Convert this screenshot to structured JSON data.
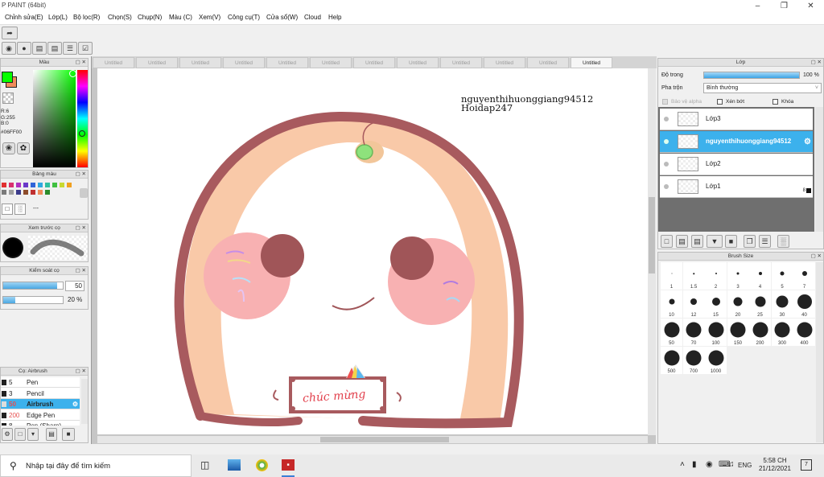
{
  "window": {
    "title": "P PAINT (64bit)"
  },
  "menu": [
    "Chỉnh sửa(E)",
    "Lớp(L)",
    "Bộ lọc(R)",
    "Chọn(S)",
    "Chụp(N)",
    "Màu (C)",
    "Xem(V)",
    "Công cụ(T)",
    "Cửa sổ(W)",
    "Cloud",
    "Help"
  ],
  "color_panel": {
    "title": "Màu",
    "r": "R:6",
    "g": "G:255",
    "b": "B:0",
    "hex": "#06FF00",
    "main_color": "#06ff00",
    "sub_color": "#f08c5a"
  },
  "swatch_panel": {
    "title": "Bảng màu",
    "dashes": "---",
    "swatches": [
      "#e03030",
      "#d8306e",
      "#b030c0",
      "#6a38c8",
      "#3064d8",
      "#30a8e0",
      "#30c0a0",
      "#40c040",
      "#c8d830",
      "#f0a020",
      "#7a7a7a",
      "#a0a0a0",
      "#3c3c8c",
      "#8c4c2c",
      "#c03030",
      "#f08c5a",
      "#2c8c2c"
    ]
  },
  "brush_preview": {
    "title": "Xem trước cọ"
  },
  "brush_control": {
    "title": "Kiểm soát cọ",
    "size": "50",
    "density": "20 %",
    "size_fill": 0.9,
    "density_fill": 0.2
  },
  "brush_list": {
    "title": "Cọ: Airbrush",
    "items": [
      {
        "size": "5",
        "name": "Pen",
        "color": "#222"
      },
      {
        "size": "3",
        "name": "Pencil",
        "color": "#222"
      },
      {
        "size": "50",
        "name": "Airbrush",
        "color": "#e65050",
        "selected": true
      },
      {
        "size": "200",
        "name": "Edge Pen",
        "color": "#e65050"
      },
      {
        "size": "8",
        "name": "Pen (Sharp)",
        "color": "#222"
      }
    ]
  },
  "tabs": [
    "Untitled",
    "Untitled",
    "Untitled",
    "Untitled",
    "Untitled",
    "Untitled",
    "Untitled",
    "Untitled",
    "Untitled",
    "Untitled",
    "Untitled",
    "Untitled"
  ],
  "canvas_text": {
    "line1": "nguyenthihuonggiang94512",
    "line2": "Hoidap247",
    "sign_text": "chúc mừng"
  },
  "layer_panel": {
    "title": "Lớp",
    "opacity_label": "Độ trong",
    "opacity_value": "100 %",
    "blend_label": "Pha trộn",
    "blend_value": "Bình thường",
    "protect_alpha": "Bảo vệ alpha",
    "clipping": "Xén bớt",
    "lock": "Khóa",
    "layers": [
      {
        "name": "Lớp3",
        "selected": false
      },
      {
        "name": "nguyenthihuonggiang94512",
        "selected": true
      },
      {
        "name": "Lớp2",
        "selected": false
      },
      {
        "name": "Lớp1",
        "selected": false,
        "badge": "8"
      }
    ]
  },
  "brush_size": {
    "title": "Brush Size",
    "sizes": [
      "1",
      "1.5",
      "2",
      "3",
      "4",
      "5",
      "7",
      "10",
      "12",
      "15",
      "20",
      "25",
      "30",
      "40",
      "50",
      "70",
      "100",
      "150",
      "200",
      "300",
      "400",
      "500",
      "700",
      "1000"
    ]
  },
  "taskbar": {
    "search_placeholder": "Nhập tại đây để tìm kiếm",
    "lang": "ENG",
    "time": "5:58 CH",
    "date": "21/12/2021",
    "notif_count": "7"
  }
}
